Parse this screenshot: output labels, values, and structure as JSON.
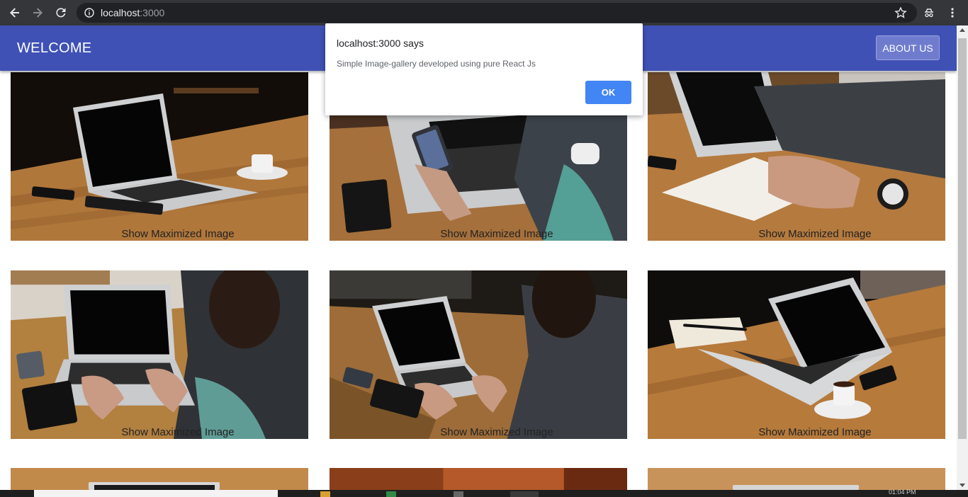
{
  "browser": {
    "url_host": "localhost",
    "url_port": ":3000",
    "icons": [
      "back-arrow-icon",
      "forward-arrow-icon",
      "reload-icon",
      "info-icon",
      "star-icon",
      "incognito-icon",
      "kebab-menu-icon"
    ]
  },
  "appbar": {
    "title": "WELCOME",
    "about_label": "ABOUT US",
    "color": "#3f51b5"
  },
  "gallery": {
    "caption": "Show Maximized Image",
    "tiles": [
      {
        "caption": "Show Maximized Image"
      },
      {
        "caption": "Show Maximized Image"
      },
      {
        "caption": "Show Maximized Image"
      },
      {
        "caption": "Show Maximized Image"
      },
      {
        "caption": "Show Maximized Image"
      },
      {
        "caption": "Show Maximized Image"
      }
    ]
  },
  "dialog": {
    "title": "localhost:3000 says",
    "message": "Simple Image-gallery developed using pure React Js",
    "ok_label": "OK",
    "ok_color": "#4285f4"
  },
  "taskbar": {
    "time": "01:04 PM"
  }
}
